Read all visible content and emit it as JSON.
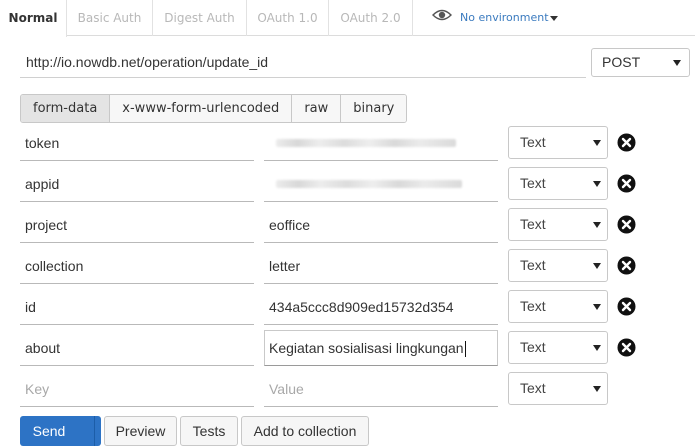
{
  "auth_tabs": [
    {
      "label": "Normal",
      "active": true
    },
    {
      "label": "Basic Auth",
      "active": false
    },
    {
      "label": "Digest Auth",
      "active": false
    },
    {
      "label": "OAuth 1.0",
      "active": false
    },
    {
      "label": "OAuth 2.0",
      "active": false
    }
  ],
  "environment": {
    "label": "No environment",
    "icon": "eye-icon"
  },
  "request": {
    "url": "http://io.nowdb.net/operation/update_id",
    "method": "POST"
  },
  "body_tabs": [
    {
      "label": "form-data",
      "active": true
    },
    {
      "label": "x-www-form-urlencoded",
      "active": false
    },
    {
      "label": "raw",
      "active": false
    },
    {
      "label": "binary",
      "active": false
    }
  ],
  "params": [
    {
      "key": "token",
      "value": "",
      "value_redacted": true,
      "type": "Text"
    },
    {
      "key": "appid",
      "value": "",
      "value_redacted": true,
      "type": "Text"
    },
    {
      "key": "project",
      "value": "eoffice",
      "type": "Text"
    },
    {
      "key": "collection",
      "value": "letter",
      "type": "Text"
    },
    {
      "key": "id",
      "value": "434a5ccc8d909ed15732d354",
      "type": "Text"
    },
    {
      "key": "about",
      "value": "Kegiatan sosialisasi lingkungan",
      "type": "Text",
      "focused": true
    }
  ],
  "new_param": {
    "key_placeholder": "Key",
    "value_placeholder": "Value",
    "type": "Text"
  },
  "actions": {
    "send": "Send",
    "preview": "Preview",
    "tests": "Tests",
    "add_to_collection": "Add to collection"
  },
  "colors": {
    "primary": "#2d73c5",
    "link": "#3b7bbf"
  }
}
